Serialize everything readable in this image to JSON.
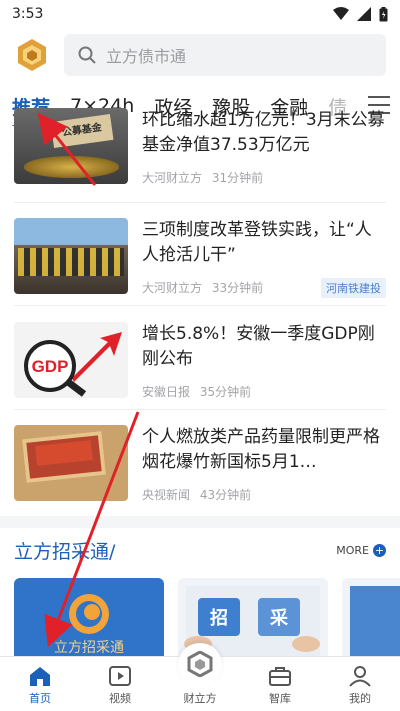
{
  "status": {
    "time": "3:53"
  },
  "search": {
    "placeholder": "立方债市通"
  },
  "tabs": [
    {
      "label": "推荐"
    },
    {
      "label": "7×24h"
    },
    {
      "label": "政经"
    },
    {
      "label": "豫股"
    },
    {
      "label": "金融"
    },
    {
      "label": "债"
    }
  ],
  "news": [
    {
      "title": "环比缩水超1万亿元！3月末公募基金净值37.53万亿元",
      "thumb_text": "公募基金",
      "source": "大河财立方",
      "time": "31分钟前"
    },
    {
      "title": "三项制度改革登铁实践，让“人人抢活儿干”",
      "source": "大河财立方",
      "time": "33分钟前",
      "tag": "河南铁建投"
    },
    {
      "title": "增长5.8%！安徽一季度GDP刚刚公布",
      "thumb_text": "GDP",
      "source": "安徽日报",
      "time": "35分钟前"
    },
    {
      "title": "个人燃放类产品药量限制更严格 烟花爆竹新国标5月1…",
      "source": "央视新闻",
      "time": "43分钟前"
    }
  ],
  "section": {
    "title": "立方招采通/",
    "more": "MORE",
    "cards": [
      {
        "text": "立方招采通"
      },
      {
        "text_a": "招",
        "text_b": "采"
      }
    ]
  },
  "nav": [
    {
      "label": "首页"
    },
    {
      "label": "视频"
    },
    {
      "label": "财立方"
    },
    {
      "label": "智库"
    },
    {
      "label": "我的"
    }
  ],
  "colors": {
    "accent": "#1c5fb8",
    "arrow": "#e0212a"
  }
}
